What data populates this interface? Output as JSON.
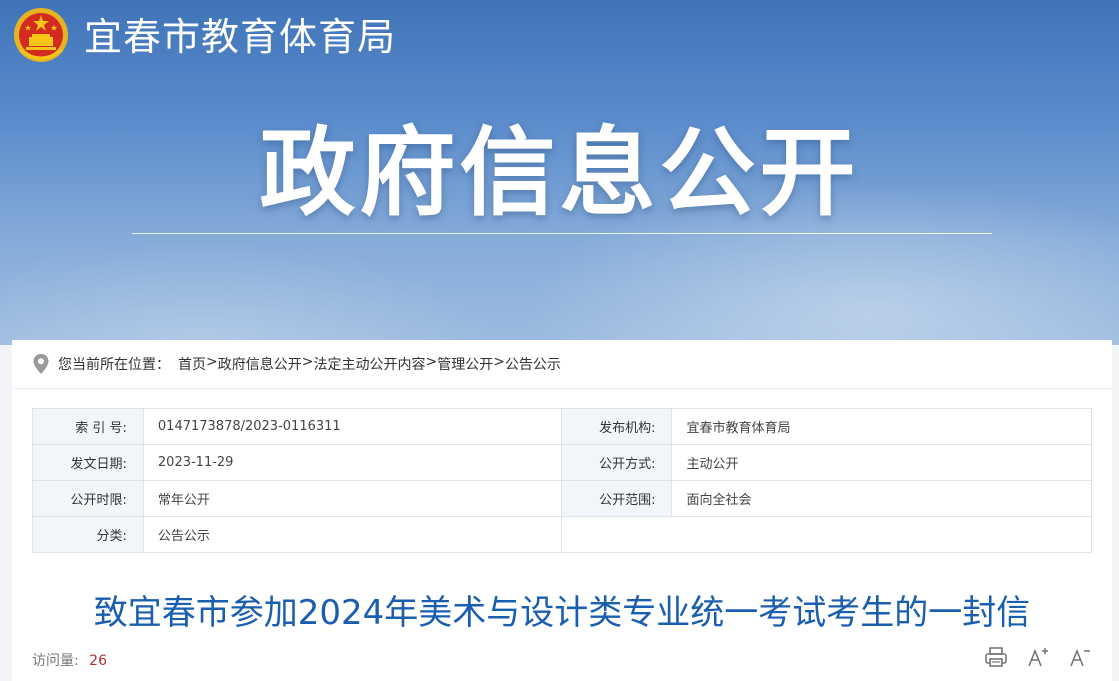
{
  "header": {
    "site_name": "宜春市教育体育局",
    "banner_title": "政府信息公开",
    "emblem_icon": "national-emblem-icon"
  },
  "breadcrumb": {
    "label": "您当前所在位置：",
    "items": [
      "首页",
      "政府信息公开",
      "法定主动公开内容",
      "管理公开",
      "公告公示"
    ],
    "separator": ">"
  },
  "meta": {
    "index_label": "索 引 号:",
    "index_value": "0147173878/2023-0116311",
    "publisher_label": "发布机构:",
    "publisher_value": "宜春市教育体育局",
    "date_label": "发文日期:",
    "date_value": "2023-11-29",
    "mode_label": "公开方式:",
    "mode_value": "主动公开",
    "period_label": "公开时限:",
    "period_value": "常年公开",
    "scope_label": "公开范围:",
    "scope_value": "面向全社会",
    "category_label": "分类:",
    "category_value": "公告公示"
  },
  "article": {
    "title": "致宜春市参加2024年美术与设计类专业统一考试考生的一封信",
    "visits_label": "访问量:",
    "visits_count": "26"
  },
  "tools": {
    "print_icon": "print-icon",
    "font_increase_icon": "font-increase-icon",
    "font_decrease_icon": "font-decrease-icon"
  },
  "colors": {
    "banner_top": "#3f74b8",
    "title_blue": "#1a5eb0",
    "label_bg": "#f2f6fb",
    "visit_count": "#b03030"
  }
}
